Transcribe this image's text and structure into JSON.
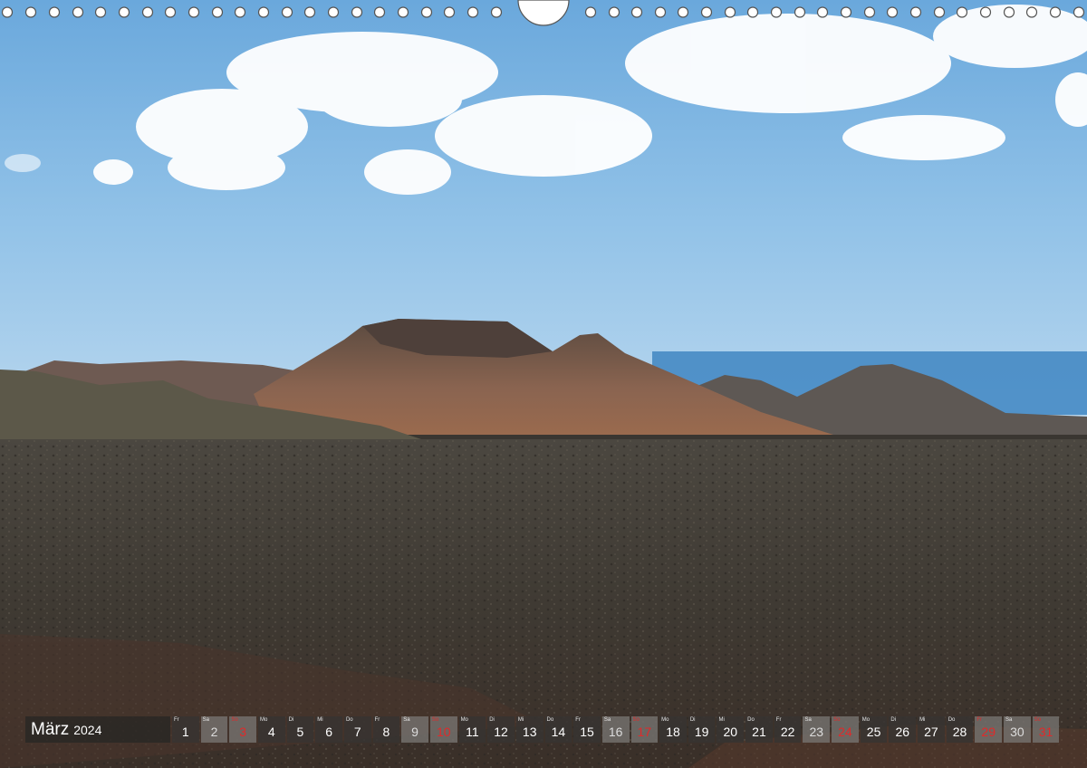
{
  "calendar": {
    "month": "März",
    "year": "2024",
    "days": [
      {
        "dn": "Fr",
        "num": "1",
        "type": "wk"
      },
      {
        "dn": "Sa",
        "num": "2",
        "type": "sa"
      },
      {
        "dn": "So",
        "num": "3",
        "type": "su"
      },
      {
        "dn": "Mo",
        "num": "4",
        "type": "wk"
      },
      {
        "dn": "Di",
        "num": "5",
        "type": "wk"
      },
      {
        "dn": "Mi",
        "num": "6",
        "type": "wk"
      },
      {
        "dn": "Do",
        "num": "7",
        "type": "wk"
      },
      {
        "dn": "Fr",
        "num": "8",
        "type": "wk"
      },
      {
        "dn": "Sa",
        "num": "9",
        "type": "sa"
      },
      {
        "dn": "So",
        "num": "10",
        "type": "su"
      },
      {
        "dn": "Mo",
        "num": "11",
        "type": "wk"
      },
      {
        "dn": "Di",
        "num": "12",
        "type": "wk"
      },
      {
        "dn": "Mi",
        "num": "13",
        "type": "wk"
      },
      {
        "dn": "Do",
        "num": "14",
        "type": "wk"
      },
      {
        "dn": "Fr",
        "num": "15",
        "type": "wk"
      },
      {
        "dn": "Sa",
        "num": "16",
        "type": "sa"
      },
      {
        "dn": "So",
        "num": "17",
        "type": "su"
      },
      {
        "dn": "Mo",
        "num": "18",
        "type": "wk"
      },
      {
        "dn": "Di",
        "num": "19",
        "type": "wk"
      },
      {
        "dn": "Mi",
        "num": "20",
        "type": "wk"
      },
      {
        "dn": "Do",
        "num": "21",
        "type": "wk"
      },
      {
        "dn": "Fr",
        "num": "22",
        "type": "wk"
      },
      {
        "dn": "Sa",
        "num": "23",
        "type": "sa"
      },
      {
        "dn": "So",
        "num": "24",
        "type": "su"
      },
      {
        "dn": "Mo",
        "num": "25",
        "type": "wk"
      },
      {
        "dn": "Di",
        "num": "26",
        "type": "wk"
      },
      {
        "dn": "Mi",
        "num": "27",
        "type": "wk"
      },
      {
        "dn": "Do",
        "num": "28",
        "type": "wk"
      },
      {
        "dn": "Fr",
        "num": "29",
        "type": "su"
      },
      {
        "dn": "Sa",
        "num": "30",
        "type": "sa"
      },
      {
        "dn": "So",
        "num": "31",
        "type": "su"
      }
    ]
  },
  "colors": {
    "sunday_red": "#e02a2a",
    "sky_blue": "#8ebee6"
  }
}
